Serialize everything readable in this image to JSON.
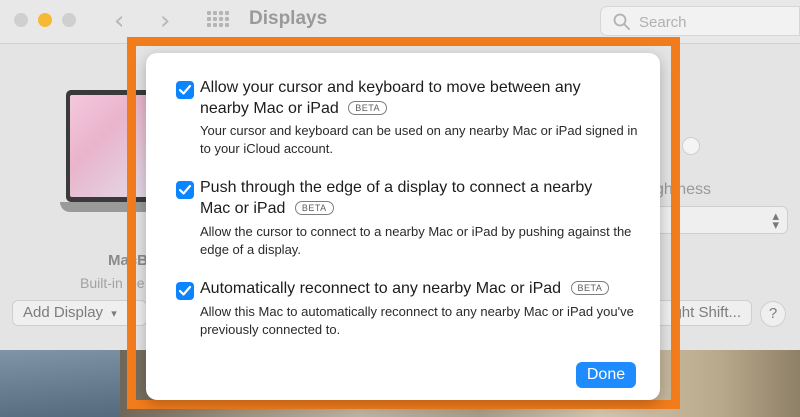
{
  "window": {
    "title": "Displays",
    "search_placeholder": "Search",
    "back_icon": "chevron-left-icon",
    "forward_icon": "chevron-right-icon",
    "grid_icon": "show-all-grid-icon",
    "mac_name_partial": "MacB",
    "mac_subtitle_partial": "Built-in Re",
    "add_display_label": "Add Display",
    "night_shift_label": "ight Shift...",
    "help_label": "?",
    "brightness_label_partial": "ghtness"
  },
  "dialog": {
    "options": [
      {
        "checked": true,
        "title": "Allow your cursor and keyboard to move between any nearby Mac or iPad",
        "badge": "BETA",
        "description": "Your cursor and keyboard can be used on any nearby Mac or iPad signed in to your iCloud account."
      },
      {
        "checked": true,
        "title": "Push through the edge of a display to connect a nearby Mac or iPad",
        "badge": "BETA",
        "description": "Allow the cursor to connect to a nearby Mac or iPad by pushing against the edge of a display."
      },
      {
        "checked": true,
        "title": "Automatically reconnect to any nearby Mac or iPad",
        "badge": "BETA",
        "description": "Allow this Mac to automatically reconnect to any nearby Mac or iPad you've previously connected to."
      }
    ],
    "done_label": "Done"
  },
  "colors": {
    "accent": "#0b84ff",
    "annotation": "#f27c1c"
  }
}
